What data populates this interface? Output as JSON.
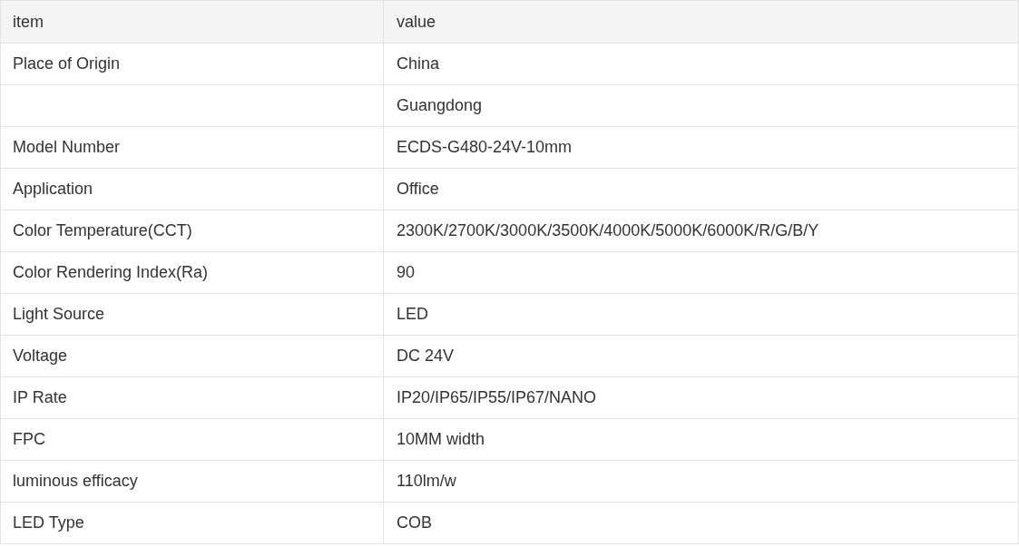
{
  "table": {
    "columns": [
      "item",
      "value"
    ],
    "rows": [
      {
        "item": "Place of Origin",
        "value": "China"
      },
      {
        "value": "Guangdong"
      },
      {
        "item": "Model Number",
        "value": "ECDS-G480-24V-10mm"
      },
      {
        "item": "Application",
        "value": "Office"
      },
      {
        "item": "Color Temperature(CCT)",
        "value": "2300K/2700K/3000K/3500K/4000K/5000K/6000K/R/G/B/Y"
      },
      {
        "item": "Color Rendering Index(Ra)",
        "value": "90"
      },
      {
        "item": "Light Source",
        "value": "LED"
      },
      {
        "item": "Voltage",
        "value": "DC 24V"
      },
      {
        "item": "IP Rate",
        "value": "IP20/IP65/IP55/IP67/NANO"
      },
      {
        "item": "FPC",
        "value": "10MM width"
      },
      {
        "item": "luminous efficacy",
        "value": "110lm/w"
      },
      {
        "item": "LED Type",
        "value": "COB"
      }
    ]
  }
}
